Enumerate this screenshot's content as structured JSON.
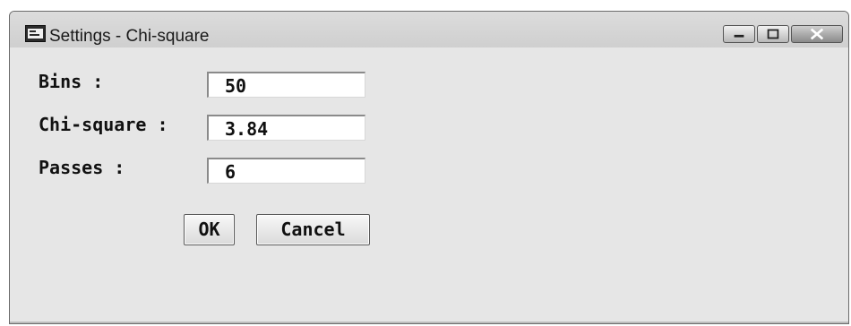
{
  "window": {
    "title": "Settings - Chi-square",
    "icon": "sas-app-icon",
    "controls": [
      "minimize-icon",
      "maximize-icon",
      "close-icon"
    ]
  },
  "form": {
    "bins_label": "Bins :",
    "bins_value": "50",
    "chisquare_label": "Chi-square :",
    "chisquare_value": "3.84",
    "passes_label": "Passes :",
    "passes_value": "6"
  },
  "buttons": {
    "ok_label": "OK",
    "cancel_label": "Cancel"
  }
}
